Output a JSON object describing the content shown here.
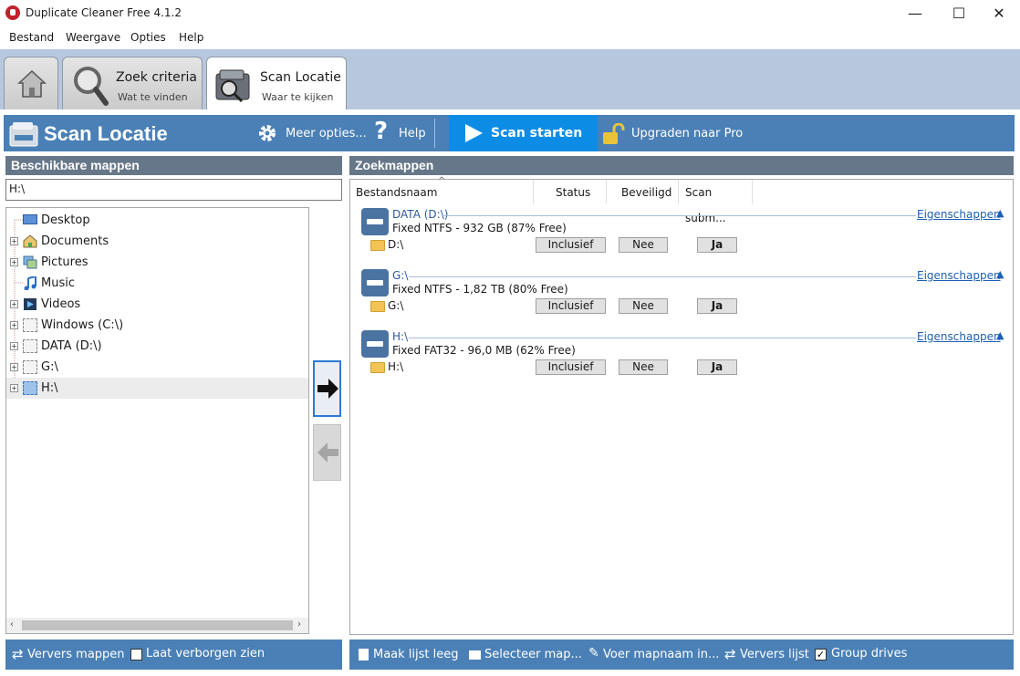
{
  "window": {
    "title": "Duplicate Cleaner Free 4.1.2",
    "minimize": "—",
    "maximize": "☐",
    "close": "✕"
  },
  "menu": [
    "Bestand",
    "Weergave",
    "Opties",
    "Help"
  ],
  "tabs": [
    {
      "title": "",
      "sub": ""
    },
    {
      "title": "Zoek criteria",
      "sub": "Wat te vinden"
    },
    {
      "title": "Scan Locatie",
      "sub": "Waar te kijken"
    }
  ],
  "toolbar": {
    "title": "Scan Locatie",
    "more_options": "Meer opties...",
    "help": "Help",
    "scan": "Scan starten",
    "upgrade": "Upgraden naar Pro"
  },
  "left_panel": {
    "header": "Beschikbare mappen",
    "path": "H:\\",
    "tree": [
      "Desktop",
      "Documents",
      "Pictures",
      "Music",
      "Videos",
      "Windows (C:\\)",
      "DATA (D:\\)",
      "G:\\",
      "H:\\"
    ]
  },
  "right_panel": {
    "header": "Zoekmappen",
    "columns": [
      "Bestandsnaam",
      "Status",
      "Beveiligd",
      "Scan subm..."
    ],
    "properties_label": "Eigenschappen",
    "drives": [
      {
        "name": "DATA (D:\\)",
        "info": "Fixed NTFS - 932 GB (87% Free)",
        "folder": "D:\\",
        "status": "Inclusief",
        "protected": "Nee",
        "scan_sub": "Ja"
      },
      {
        "name": "G:\\",
        "info": "Fixed NTFS - 1,82 TB (80% Free)",
        "folder": "G:\\",
        "status": "Inclusief",
        "protected": "Nee",
        "scan_sub": "Ja"
      },
      {
        "name": "H:\\",
        "info": "Fixed FAT32 - 96,0 MB (62% Free)",
        "folder": "H:\\",
        "status": "Inclusief",
        "protected": "Nee",
        "scan_sub": "Ja"
      }
    ]
  },
  "bottom_left": {
    "refresh": "Ververs mappen",
    "show_hidden": "Laat verborgen zien"
  },
  "bottom_right": {
    "clear": "Maak lijst leeg",
    "select": "Selecteer map...",
    "enter": "Voer mapnaam in...",
    "refresh": "Ververs lijst",
    "group": "Group drives"
  },
  "colors": {
    "accent": "#4a80b6",
    "scan_button": "#0d8ce6",
    "panel_header": "#667789",
    "tab_strip": "#b7c7dd"
  }
}
